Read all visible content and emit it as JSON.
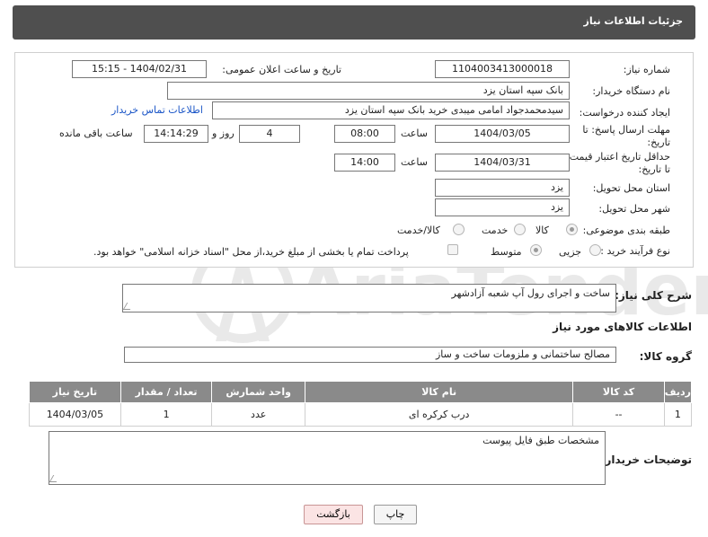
{
  "header": {
    "title": "جزئیات اطلاعات نیاز"
  },
  "fields": {
    "need_number_label": "شماره نیاز:",
    "need_number": "1104003413000018",
    "announce_label": "تاریخ و ساعت اعلان عمومی:",
    "announce_value": "1404/02/31 - 15:15",
    "buyer_org_label": "نام دستگاه خریدار:",
    "buyer_org": "بانک سپه استان یزد",
    "creator_label": "ایجاد کننده درخواست:",
    "creator": "سیدمحمدجواد امامی میبدی خرید   بانک سپه استان یزد",
    "buyer_contact_link": "اطلاعات تماس خریدار",
    "deadline_label_1": "مهلت ارسال پاسخ: تا",
    "deadline_label_2": "تاریخ:",
    "deadline_date": "1404/03/05",
    "time_label": "ساعت",
    "deadline_time": "08:00",
    "days_value": "4",
    "days_label": "روز و",
    "remaining_time": "14:14:29",
    "remaining_label": "ساعت باقی مانده",
    "price_validity_label_1": "حداقل تاریخ اعتبار قیمت:",
    "price_validity_label_2": "تا تاریخ:",
    "price_validity_date": "1404/03/31",
    "price_validity_time": "14:00",
    "delivery_province_label": "استان محل تحویل:",
    "delivery_province": "یزد",
    "delivery_city_label": "شهر محل تحویل:",
    "delivery_city": "یزد",
    "category_label": "طبقه بندی موضوعی:",
    "category_options": [
      "کالا",
      "خدمت",
      "کالا/خدمت"
    ],
    "process_label": "نوع فرآیند خرید :",
    "process_options": [
      "جزیی",
      "متوسط"
    ],
    "payment_note": "پرداخت تمام یا بخشی از مبلغ خرید،از محل \"اسناد خزانه اسلامی\" خواهد بود."
  },
  "description": {
    "label": "شرح کلی نیاز:",
    "value": "ساخت و اجرای رول آپ شعبه آزادشهر"
  },
  "goods_section": {
    "title": "اطلاعات کالاهای مورد نیاز",
    "group_label": "گروه کالا:",
    "group_value": "مصالح ساختمانی و ملزومات ساخت و ساز"
  },
  "table": {
    "headers": [
      "ردیف",
      "کد کالا",
      "نام کالا",
      "واحد شمارش",
      "تعداد / مقدار",
      "تاریخ نیاز"
    ],
    "rows": [
      [
        "1",
        "--",
        "درب کرکره ای",
        "عدد",
        "1",
        "1404/03/05"
      ]
    ]
  },
  "buyer_notes": {
    "label": "توضیحات خریدار:",
    "value": "مشخصات طبق فایل پیوست"
  },
  "buttons": {
    "print": "چاپ",
    "back": "بازگشت"
  },
  "watermark": {
    "text": "AriaTender.net"
  },
  "colors": {
    "header_bg": "#4f4f4f",
    "link": "#1a55c7",
    "table_header": "#8a8a8a",
    "back_button": "#fbe4e4"
  }
}
